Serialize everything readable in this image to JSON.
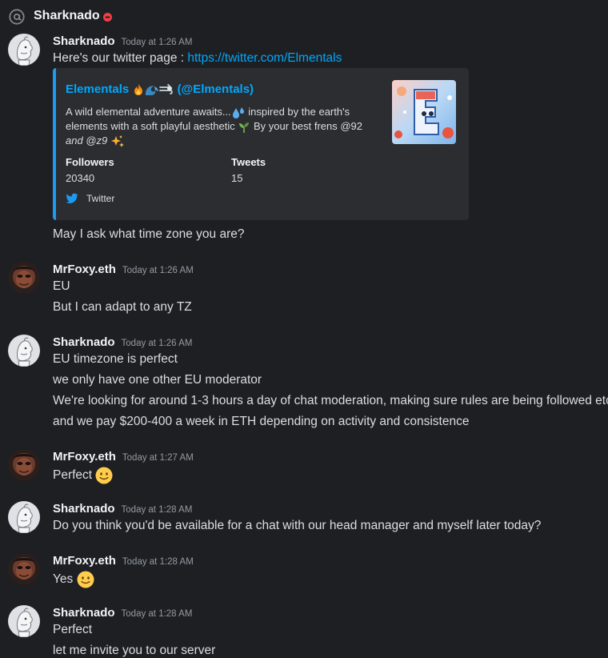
{
  "header": {
    "title": "Sharknado",
    "status": "do-not-disturb"
  },
  "colors": {
    "background": "#1e1f22",
    "link": "#00a8fc",
    "twitter_blue": "#1d9bf0",
    "embed_bg": "#2b2d31"
  },
  "messages": [
    {
      "author": "Sharknado",
      "timestamp": "Today at 1:26 AM",
      "text_prefix": "Here's our twitter page : ",
      "link": "https://twitter.com/Elmentals",
      "embed": {
        "title_name": "Elementals",
        "title_emojis": [
          "fire-emoji",
          "wave-emoji",
          "wind-emoji"
        ],
        "title_handle": "(@Elmentals)",
        "description_line1_a": "A wild elemental adventure awaits...",
        "description_line1_b": "inspired by the earth's",
        "description_line2_a": "elements with a soft playful aesthetic",
        "description_line2_b": "By your best frens @92",
        "description_line3": "and @z9",
        "fields": [
          {
            "name": "Followers",
            "value": "20340"
          },
          {
            "name": "Tweets",
            "value": "15"
          }
        ],
        "footer": "Twitter"
      },
      "extra_line": "May I ask what time zone you are?"
    },
    {
      "author": "MrFoxy.eth",
      "timestamp": "Today at 1:26 AM",
      "lines": [
        "EU",
        "But I can adapt to any TZ"
      ]
    },
    {
      "author": "Sharknado",
      "timestamp": "Today at 1:26 AM",
      "lines": [
        "EU timezone is perfect",
        "we only have one other EU moderator",
        "We're looking for around 1-3 hours a day of chat moderation, making sure rules are being followed etc",
        "and we pay $200-400 a week in ETH depending on activity and consistence"
      ]
    },
    {
      "author": "MrFoxy.eth",
      "timestamp": "Today at 1:27 AM",
      "text": "Perfect",
      "emoji": "slightly-smiling-face"
    },
    {
      "author": "Sharknado",
      "timestamp": "Today at 1:28 AM",
      "lines": [
        "Do you think you'd be available for a chat with our head manager and myself later today?"
      ]
    },
    {
      "author": "MrFoxy.eth",
      "timestamp": "Today at 1:28 AM",
      "text": "Yes",
      "emoji": "slightly-smiling-face"
    },
    {
      "author": "Sharknado",
      "timestamp": "Today at 1:28 AM",
      "lines": [
        "Perfect",
        "let me invite you to our server"
      ]
    }
  ]
}
